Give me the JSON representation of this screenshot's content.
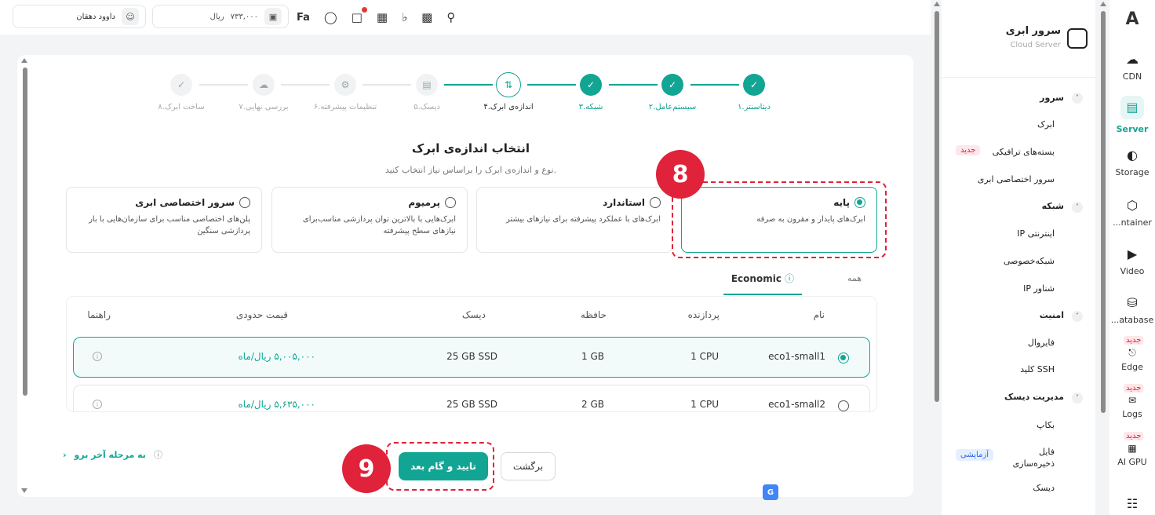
{
  "topbar": {
    "user_name": "داوود دهقان",
    "balance": "۷۳۳,۰۰۰",
    "currency": "ریال",
    "lang": "Fa"
  },
  "stepper": {
    "steps": [
      {
        "label": "۱.دیتاسنتر",
        "state": "done"
      },
      {
        "label": "۲.سیستم‌عامل",
        "state": "done"
      },
      {
        "label": "۳.شبکه",
        "state": "done"
      },
      {
        "label": "۴.اندازه‌ی ابرک",
        "state": "current"
      },
      {
        "label": "۵.دیسک",
        "state": "todo"
      },
      {
        "label": "۶.تنظیمات پیشرفته",
        "state": "todo"
      },
      {
        "label": "۷.بررسی نهایی",
        "state": "todo"
      },
      {
        "label": "۸.ساخت ابرک",
        "state": "todo"
      }
    ]
  },
  "heading": {
    "title": "انتخاب اندازه‌ی ابرک",
    "subtitle": "نوع و اندازه‌ی ابرک را براساس نیاز انتخاب کنید."
  },
  "types": [
    {
      "name": "پایه",
      "desc": "ابرک‌های پایدار و مقرون به صرفه",
      "selected": true
    },
    {
      "name": "استاندارد",
      "desc": "ابرک‌های با عملکرد پیشرفته برای نیازهای بیشتر",
      "selected": false
    },
    {
      "name": "پرمیوم",
      "desc": "ابرک‌هایی با بالاترین توان پردازشی مناسب‌برای نیازهای سطح پیشرفته",
      "selected": false
    },
    {
      "name": "سرور اختصاصی ابری",
      "desc": "پلن‌های اختصاصی مناسب برای سازمان‌هایی با بار پردازشی سنگین",
      "selected": false
    }
  ],
  "tabs": {
    "active": "Economic",
    "all": "همه"
  },
  "table": {
    "headers": {
      "name": "نام",
      "cpu": "پردازنده",
      "ram": "حافظه",
      "disk": "دیسک",
      "price": "قیمت حدودی",
      "help": "راهنما"
    },
    "rows": [
      {
        "name": "eco1-small1",
        "cpu": "1 CPU",
        "ram": "1 GB",
        "disk": "25 GB SSD",
        "price": "۵,۰۰۵,۰۰۰ ریال/ماه",
        "selected": true
      },
      {
        "name": "eco1-small2",
        "cpu": "1 CPU",
        "ram": "2 GB",
        "disk": "25 GB SSD",
        "price": "۵,۶۳۵,۰۰۰ ریال/ماه",
        "selected": false
      }
    ]
  },
  "actions": {
    "next": "تایید و گام بعد",
    "back": "برگشت",
    "skip": "به مرحله آخر برو"
  },
  "annotations": {
    "badge8": "8",
    "badge9": "9"
  },
  "subsidebar": {
    "title": "سرور ابری",
    "subtitle": "Cloud Server",
    "groups": [
      {
        "label": "سرور",
        "items": [
          {
            "label": "ابرک"
          },
          {
            "label": "بسته‌های ترافیکی",
            "tag": "جدید"
          },
          {
            "label": "سرور اختصاصی ابری"
          }
        ]
      },
      {
        "label": "شبکه",
        "items": [
          {
            "label": "IP اینترنتی"
          },
          {
            "label": "شبکه‌خصوصی"
          },
          {
            "label": "IP شناور"
          }
        ]
      },
      {
        "label": "امنیت",
        "items": [
          {
            "label": "فایروال"
          },
          {
            "label": "کلید SSH"
          }
        ]
      },
      {
        "label": "مدیریت دیسک",
        "items": [
          {
            "label": "بکاپ"
          },
          {
            "label": "فایل ذخیره‌سازی",
            "tag": "آزمایشی"
          },
          {
            "label": "دیسک"
          }
        ]
      }
    ]
  },
  "rail": {
    "logo": "A",
    "items": [
      {
        "label": "CDN",
        "icon": "cloud-globe-icon"
      },
      {
        "label": "Server",
        "icon": "server-icon",
        "active": true
      },
      {
        "label": "Storage",
        "icon": "storage-icon"
      },
      {
        "label": "...ntainer",
        "icon": "container-icon"
      },
      {
        "label": "Video",
        "icon": "video-icon"
      },
      {
        "label": "...atabase",
        "icon": "database-icon"
      },
      {
        "label": "Edge",
        "icon": "edge-icon",
        "tag": "جدید"
      },
      {
        "label": "Logs",
        "icon": "logs-icon",
        "tag": "جدید"
      },
      {
        "label": "AI GPU",
        "icon": "gpu-icon",
        "tag": "جدید"
      }
    ]
  },
  "colors": {
    "accent": "#12a594",
    "highlight": "#e0223a"
  }
}
